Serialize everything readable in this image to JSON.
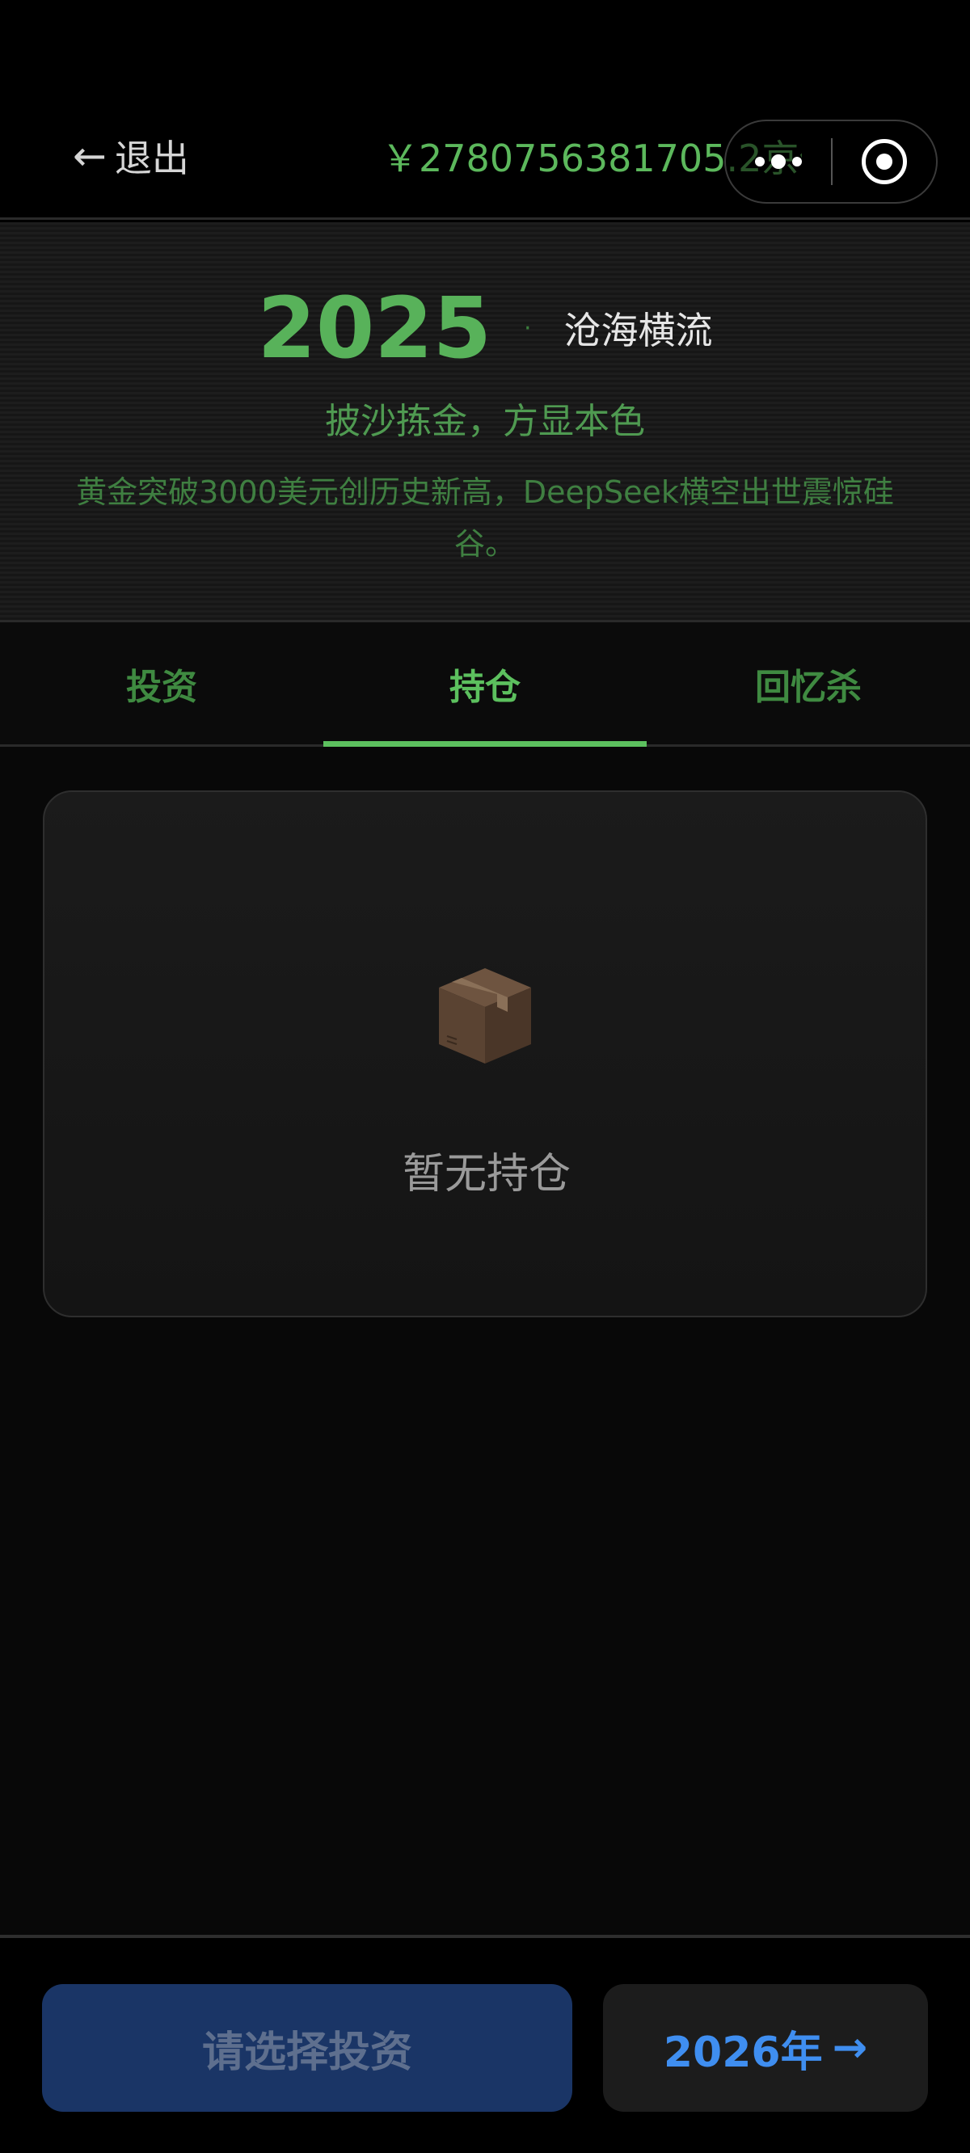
{
  "topbar": {
    "exit_icon": "arrow-left-icon",
    "exit_arrow": "←",
    "exit_label": "退出",
    "balance": "￥2780756381705.2京亿",
    "capsule_icons": [
      "more-icon",
      "close-icon"
    ]
  },
  "year_header": {
    "year": "2025",
    "separator": "·",
    "title": "沧海横流",
    "motto": "披沙拣金，方显本色",
    "news": "黄金突破3000美元创历史新高，DeepSeek横空出世震惊硅谷。"
  },
  "tabs": [
    {
      "label": "投资",
      "active": false
    },
    {
      "label": "持仓",
      "active": true
    },
    {
      "label": "回忆杀",
      "active": false
    }
  ],
  "holdings": {
    "empty_icon": "package-box-icon",
    "empty_text": "暂无持仓"
  },
  "bottom": {
    "select_label": "请选择投资",
    "next_label": "2026年",
    "next_arrow": "→"
  },
  "colors": {
    "accent_green": "#5cc05e",
    "blue_button": "#1a3566",
    "blue_text": "#3f8ef0"
  }
}
